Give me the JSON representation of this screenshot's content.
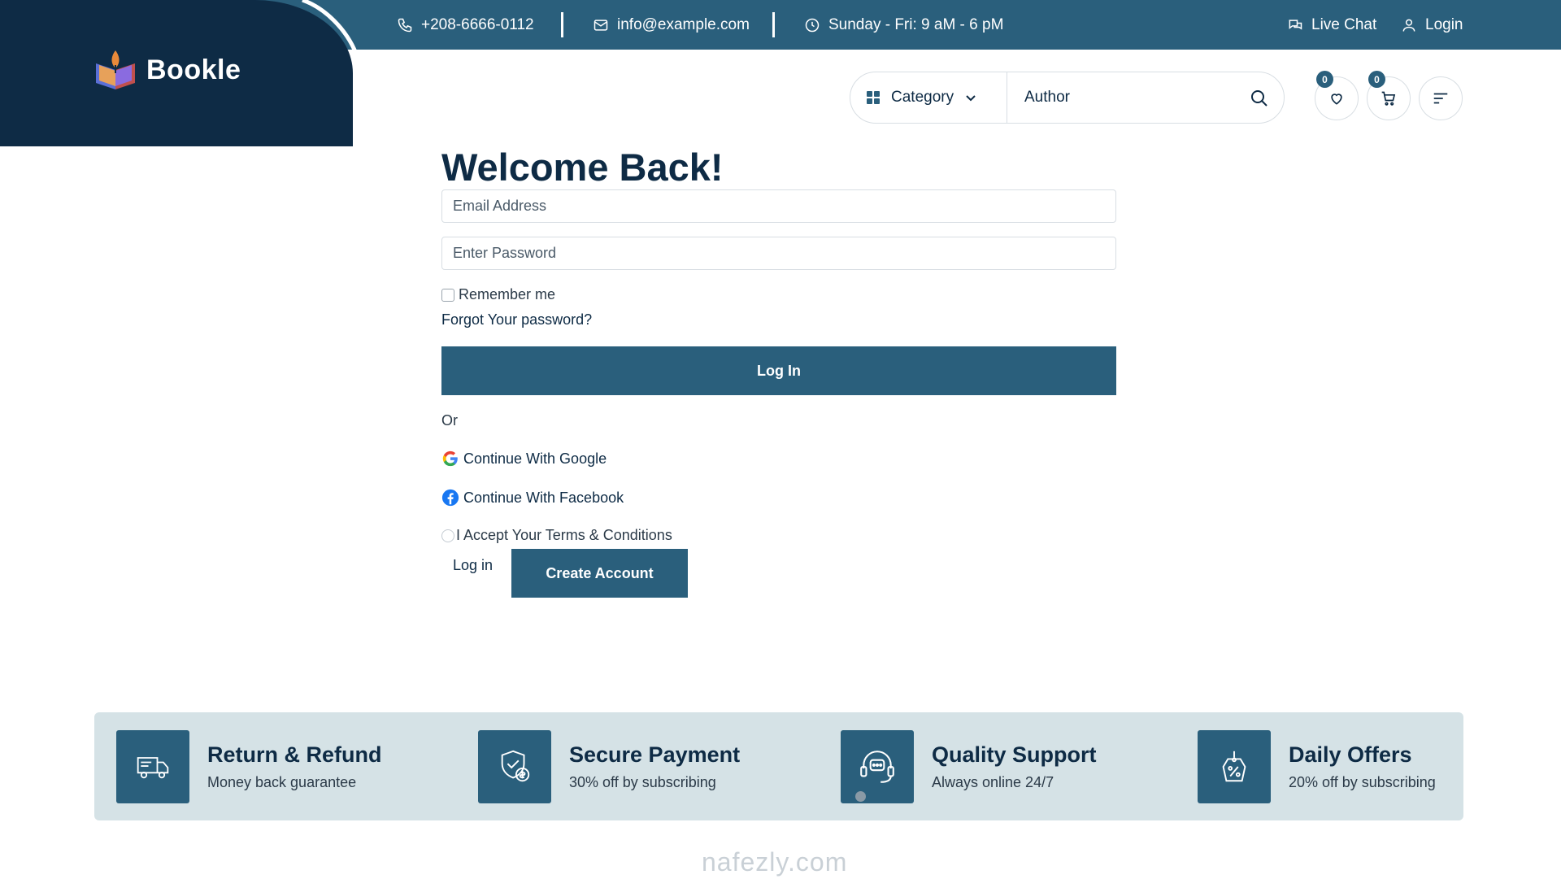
{
  "topbar": {
    "phone": "+208-6666-0112",
    "email": "info@example.com",
    "hours": "Sunday - Fri: 9 aM - 6 pM",
    "live_chat": "Live Chat",
    "login": "Login"
  },
  "brand": {
    "name": "Bookle"
  },
  "header": {
    "category_label": "Category",
    "author_value": "Author",
    "wishlist_count": "0",
    "cart_count": "0"
  },
  "form": {
    "title": "Welcome Back!",
    "email_placeholder": "Email Address",
    "password_placeholder": "Enter Password",
    "remember_label": "Remember me",
    "forgot_label": "Forgot Your password?",
    "login_button": "Log In",
    "or_label": "Or",
    "google_label": "Continue With Google",
    "facebook_label": "Continue With Facebook",
    "terms_label": "I Accept Your Terms & Conditions",
    "login_link": "Log in",
    "create_button": "Create Account"
  },
  "features": [
    {
      "title": "Return & Refund",
      "subtitle": "Money back guarantee",
      "icon": "truck-icon"
    },
    {
      "title": "Secure Payment",
      "subtitle": "30% off by subscribing",
      "icon": "shield-payment-icon"
    },
    {
      "title": "Quality Support",
      "subtitle": "Always online 24/7",
      "icon": "headset-icon"
    },
    {
      "title": "Daily Offers",
      "subtitle": "20% off by subscribing",
      "icon": "discount-tag-icon"
    }
  ],
  "watermark": "nafezly.com",
  "colors": {
    "primary": "#2a5f7c",
    "dark": "#0e2b45",
    "feature_bg": "#d5e2e6"
  }
}
